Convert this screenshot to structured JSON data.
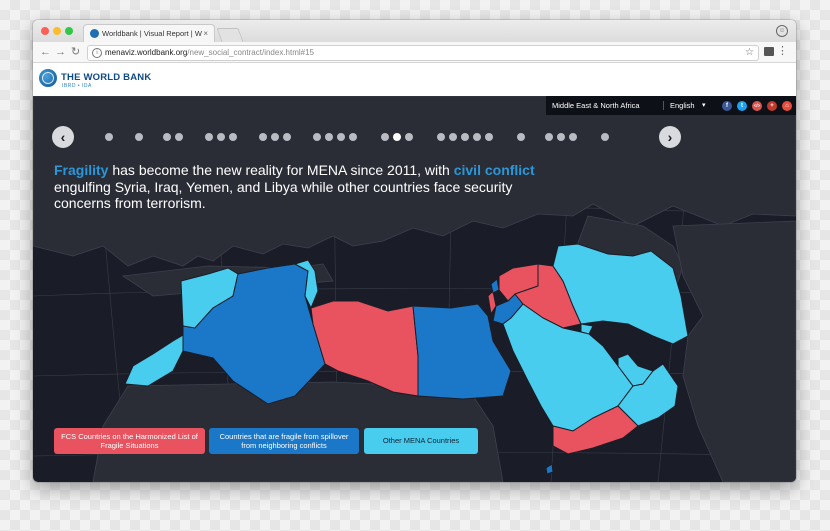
{
  "browser": {
    "tab_title": "Worldbank | Visual Report | W",
    "tab_close": "×",
    "url_host": "menaviz.worldbank.org",
    "url_path": "/new_social_contract/index.html#15",
    "nav_back": "←",
    "nav_forward": "→",
    "nav_reload": "↻",
    "info_glyph": "i",
    "star_glyph": "☆",
    "menu_glyph": "⋮",
    "profile_glyph": "☺",
    "traffic_lights": [
      "#fc5f57",
      "#fdbc2e",
      "#33c748"
    ]
  },
  "site": {
    "brand": "THE WORLD BANK",
    "brand_sub": "IBRD • IDA",
    "brand_color": "#0d4a86",
    "region": "Middle East & North Africa",
    "language": "English",
    "language_chevron": "▾",
    "social": [
      {
        "name": "facebook-icon",
        "glyph": "f",
        "color": "#3b5998"
      },
      {
        "name": "twitter-icon",
        "glyph": "t",
        "color": "#1da1f2"
      },
      {
        "name": "embed-icon",
        "glyph": "</>",
        "color": "#d9534f"
      },
      {
        "name": "share-icon",
        "glyph": "+",
        "color": "#c0392b"
      },
      {
        "name": "home-icon",
        "glyph": "⌂",
        "color": "#e74c3c"
      }
    ]
  },
  "slider": {
    "prev": "‹",
    "next": "›",
    "active_group": 7,
    "active_index_in_group": 1
  },
  "headline": {
    "part1_highlight": "Fragility",
    "part2": " has become the new reality for MENA since 2011, with ",
    "part3_highlight": "civil conflict",
    "part4": " engulfing Syria, Iraq, Yemen, and Libya while other countries face security concerns from terrorism."
  },
  "legend": [
    {
      "label": "FCS Countries on the Harmonized List of Fragile Situations",
      "color": "#e8535f"
    },
    {
      "label": "Countries that are fragile from spillover from neighboring conflicts",
      "color": "#1b78c8"
    },
    {
      "label": "Other MENA Countries",
      "color": "#48cdee"
    }
  ],
  "colors": {
    "fcs": "#e8535f",
    "spillover": "#1b78c8",
    "other": "#48cdee",
    "land": "#2a2d36",
    "ocean": "#1a1d27",
    "highlight_text": "#2a97d9"
  }
}
